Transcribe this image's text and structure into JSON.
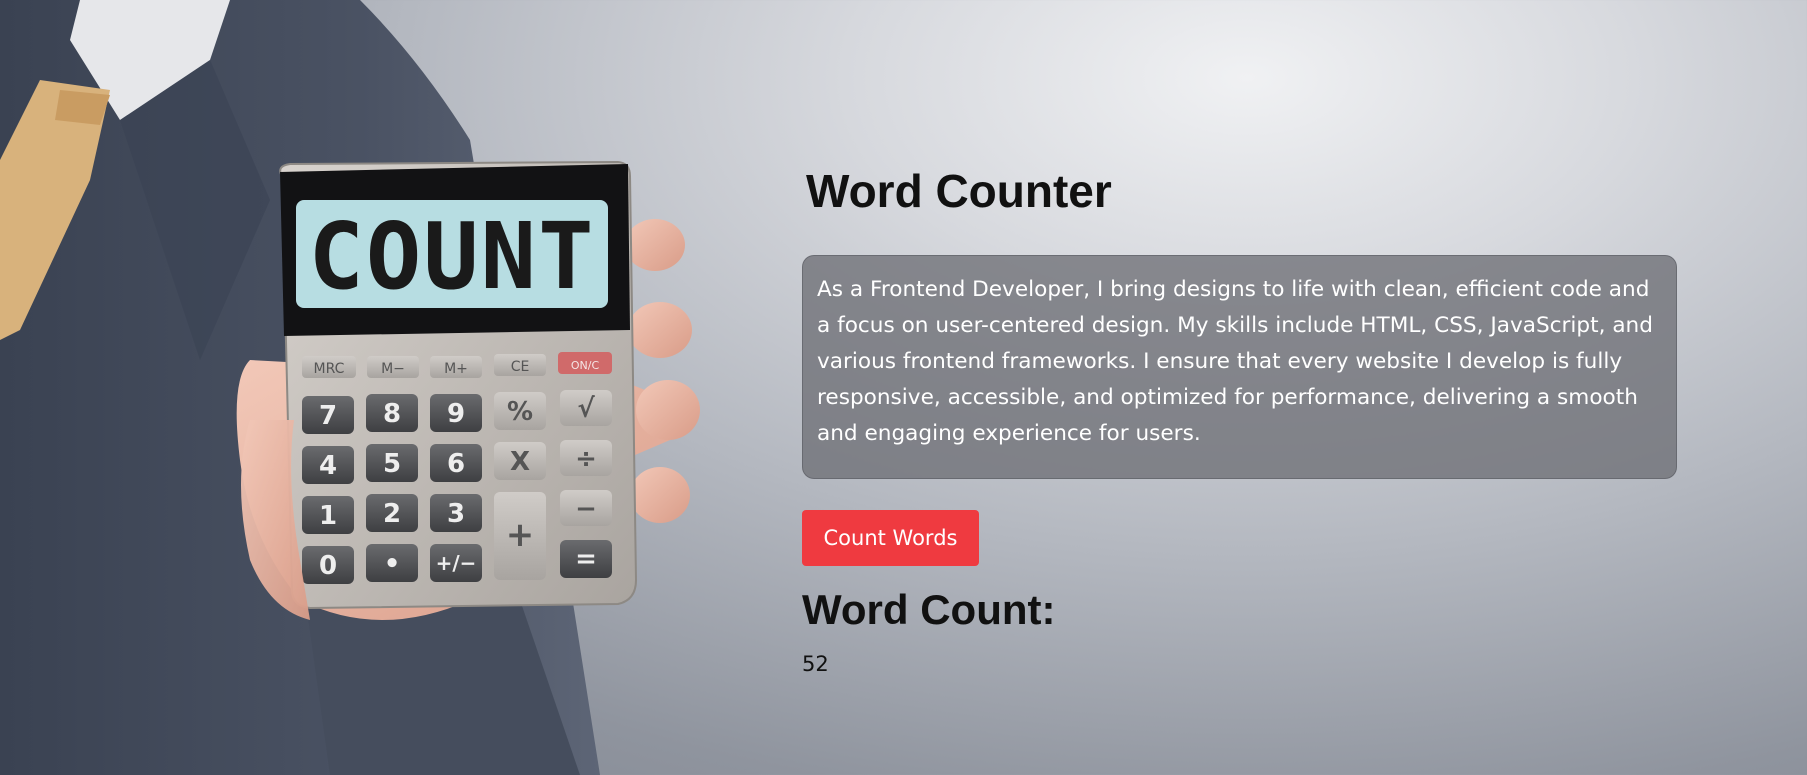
{
  "hero": {
    "display_text": "COUNT",
    "keys_top": [
      "MRC",
      "M−",
      "M+",
      "CE",
      "ON/C"
    ],
    "keys_rows": [
      [
        "7",
        "8",
        "9",
        "%",
        "√"
      ],
      [
        "4",
        "5",
        "6",
        "X",
        "÷"
      ],
      [
        "1",
        "2",
        "3",
        "",
        "−"
      ],
      [
        "0",
        "•",
        "+/−",
        "",
        "="
      ]
    ],
    "plus_key": "+"
  },
  "app": {
    "title": "Word Counter",
    "text_value": "As a Frontend Developer, I bring designs to life with clean, efficient code and a focus on user-centered design. My skills include HTML, CSS, JavaScript, and various frontend frameworks. I ensure that every website I develop is fully responsive, accessible, and optimized for performance, delivering a smooth and engaging experience for users.",
    "button_label": "Count Words",
    "result_heading": "Word Count:",
    "result_value": "52"
  },
  "colors": {
    "button": "#ef3a40",
    "textbox_bg": "#6e7076",
    "display_bg": "#b7dde2"
  }
}
